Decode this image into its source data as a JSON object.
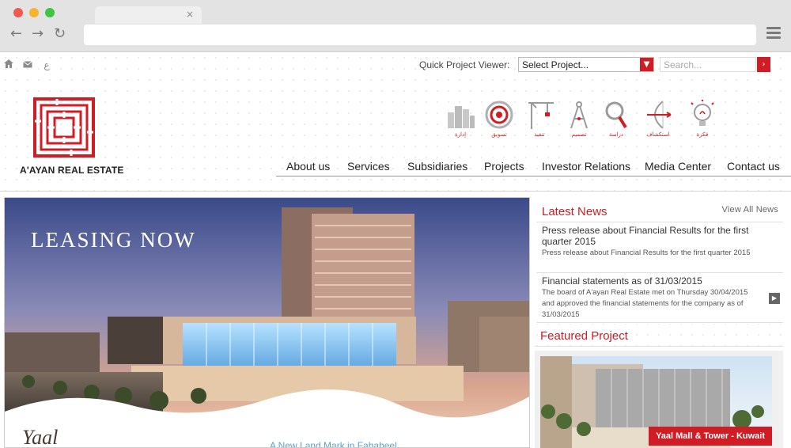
{
  "browser": {
    "tab_close": "×",
    "back": "←",
    "forward": "→",
    "reload": "↻"
  },
  "toplinks": {
    "home_icon": "home-icon",
    "mail_icon": "mail-icon",
    "lang": "ع"
  },
  "quick_project": {
    "label": "Quick Project Viewer:",
    "selected": "Select Project...",
    "arrow": "▼"
  },
  "search": {
    "placeholder": "Search...",
    "button": "›"
  },
  "logo": {
    "text": "A'AYAN REAL ESTATE"
  },
  "stage_icons": [
    {
      "icon": "buildings-icon",
      "label": "إدارة"
    },
    {
      "icon": "target-icon",
      "label": "تسويق"
    },
    {
      "icon": "crane-icon",
      "label": "تنفيذ"
    },
    {
      "icon": "compass-icon",
      "label": "تصميم"
    },
    {
      "icon": "magnifier-icon",
      "label": "دراسة"
    },
    {
      "icon": "bow-icon",
      "label": "استكشاف"
    },
    {
      "icon": "lightbulb-icon",
      "label": "فكرة"
    }
  ],
  "nav": {
    "items": [
      "About us",
      "Services",
      "Subsidiaries",
      "Projects",
      "Investor Relations",
      "Media Center",
      "Contact us"
    ]
  },
  "hero": {
    "title": "LEASING NOW",
    "script": "Yaal",
    "subtitle": "A New Land Mark in Fahaheel"
  },
  "news": {
    "heading": "Latest News",
    "view_all": "View All News",
    "arrow": "▶",
    "items": [
      {
        "title": "Press release about Financial Results for the first quarter 2015",
        "desc": "Press release about Financial Results for the first quarter 2015"
      },
      {
        "title": "Financial statements as of 31/03/2015",
        "desc": "The board of A'ayan Real Estate met on Thursday 30/04/2015 and approved the financial statements for the company as of 31/03/2015"
      }
    ]
  },
  "featured": {
    "heading": "Featured Project",
    "label": "Yaal Mall & Tower - Kuwait"
  },
  "colors": {
    "brand_red": "#d01c24",
    "chrome": "#e3e3e3"
  }
}
